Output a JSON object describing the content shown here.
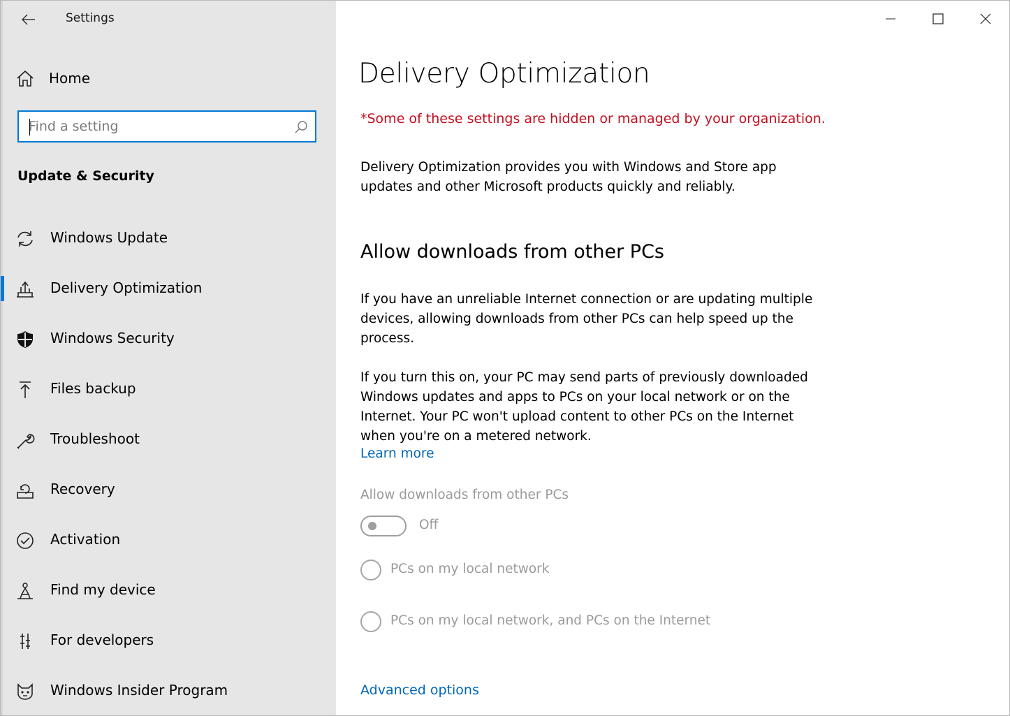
{
  "window": {
    "app_title": "Settings"
  },
  "sidebar": {
    "home_label": "Home",
    "search_placeholder": "Find a setting",
    "section_title": "Update & Security",
    "items": [
      {
        "label": "Windows Update",
        "icon": "sync-icon"
      },
      {
        "label": "Delivery Optimization",
        "icon": "delivery-optimization-icon",
        "selected": true
      },
      {
        "label": "Windows Security",
        "icon": "shield-icon"
      },
      {
        "label": "Files backup",
        "icon": "upload-arrow-icon"
      },
      {
        "label": "Troubleshoot",
        "icon": "wrench-icon"
      },
      {
        "label": "Recovery",
        "icon": "recovery-icon"
      },
      {
        "label": "Activation",
        "icon": "check-circle-icon"
      },
      {
        "label": "Find my device",
        "icon": "person-location-icon"
      },
      {
        "label": "For developers",
        "icon": "developer-tools-icon"
      },
      {
        "label": "Windows Insider Program",
        "icon": "insider-cat-icon"
      }
    ]
  },
  "main": {
    "title": "Delivery Optimization",
    "managed_notice": "*Some of these settings are hidden or managed by your organization.",
    "description": "Delivery Optimization provides you with Windows and Store app updates and other Microsoft products quickly and reliably.",
    "section_title": "Allow downloads from other PCs",
    "paragraph1": "If you have an unreliable Internet connection or are updating multiple devices, allowing downloads from other PCs can help speed up the process.",
    "paragraph2": "If you turn this on, your PC may send parts of previously downloaded Windows updates and apps to PCs on your local network or on the Internet. Your PC won't upload content to other PCs on the Internet when you're on a metered network.",
    "learn_more": "Learn more",
    "toggle_label": "Allow downloads from other PCs",
    "toggle_state": "Off",
    "radio_options": [
      "PCs on my local network",
      "PCs on my local network, and PCs on the Internet"
    ],
    "advanced_options": "Advanced options"
  },
  "colors": {
    "accent": "#0078d7",
    "link": "#0067b8",
    "warning": "#c50f1f",
    "sidebar_bg": "#e6e6e6",
    "disabled": "#9a9a9a"
  }
}
